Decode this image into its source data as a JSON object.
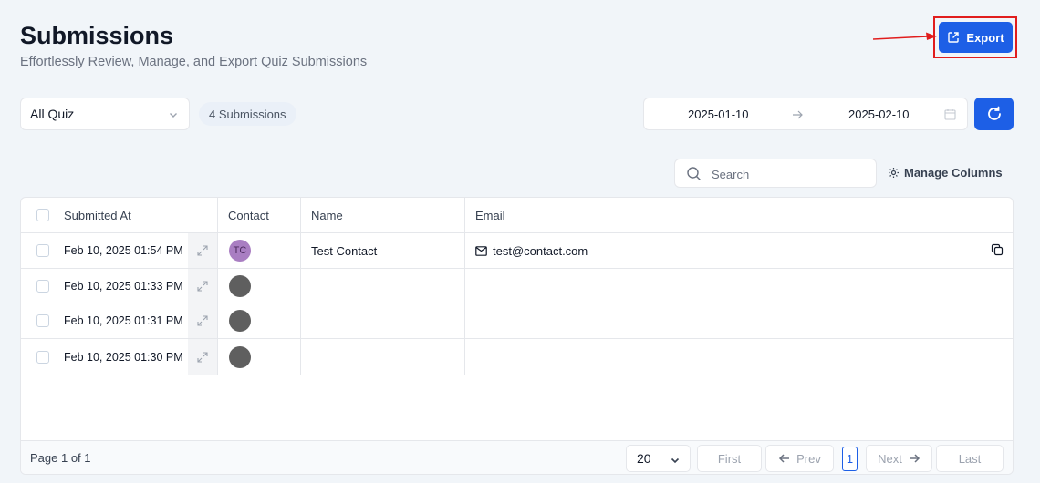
{
  "header": {
    "title": "Submissions",
    "subtitle": "Effortlessly Review, Manage, and Export Quiz Submissions",
    "export_label": "Export"
  },
  "filters": {
    "quiz_select": "All Quiz",
    "submission_count": "4 Submissions",
    "date_start": "2025-01-10",
    "date_end": "2025-02-10"
  },
  "toolbar": {
    "search_placeholder": "Search",
    "manage_columns_label": "Manage Columns"
  },
  "table": {
    "columns": [
      "Submitted At",
      "Contact",
      "Name",
      "Email"
    ],
    "rows": [
      {
        "submitted_at": "Feb 10, 2025  01:54 PM",
        "avatar_initials": "TC",
        "name": "Test Contact",
        "email": "test@contact.com"
      },
      {
        "submitted_at": "Feb 10, 2025  01:33 PM",
        "avatar_initials": "",
        "name": "",
        "email": ""
      },
      {
        "submitted_at": "Feb 10, 2025  01:31 PM",
        "avatar_initials": "",
        "name": "",
        "email": ""
      },
      {
        "submitted_at": "Feb 10, 2025  01:30 PM",
        "avatar_initials": "",
        "name": "",
        "email": ""
      }
    ]
  },
  "pagination": {
    "page_info": "Page 1 of 1",
    "per_page": "20",
    "first_label": "First",
    "prev_label": "Prev",
    "current_page": "1",
    "next_label": "Next",
    "last_label": "Last"
  },
  "colors": {
    "primary": "#1d5fe6",
    "highlight": "#e11d1d",
    "avatar_tc": "#a97ec2",
    "avatar_default": "#5f5f5f"
  }
}
